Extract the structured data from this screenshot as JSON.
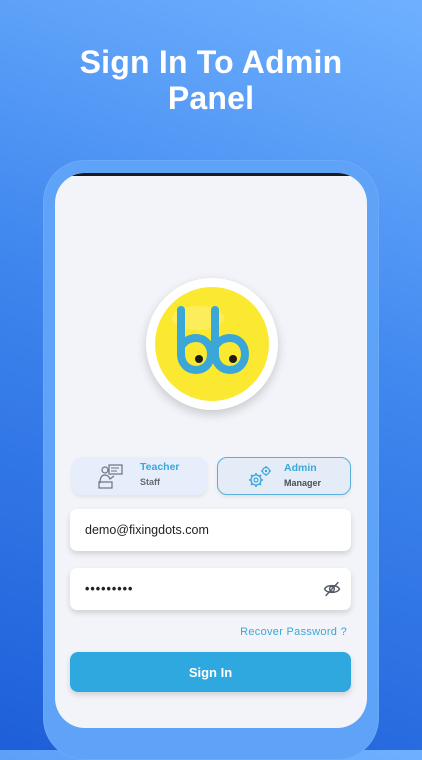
{
  "headline": {
    "line1": "Sign In To Admin",
    "line2": "Panel"
  },
  "logo": {
    "icon": "bb-logo",
    "fill_color": "#fbe831",
    "letter_color": "#3aa7d8"
  },
  "roles": [
    {
      "title": "Teacher",
      "subtitle": "Staff",
      "icon": "teacher-board-icon",
      "selected": false
    },
    {
      "title": "Admin",
      "subtitle": "Manager",
      "icon": "gears-icon",
      "selected": true
    }
  ],
  "form": {
    "email_value": "demo@fixingdots.com",
    "password_value": "•••••••••",
    "password_toggle_icon": "eye-slash-icon",
    "recover_label": "Recover Password ?",
    "signin_label": "Sign In"
  },
  "colors": {
    "accent": "#2fa8e0",
    "background": "#3f86ee",
    "card_bg": "#f2f4f9"
  }
}
